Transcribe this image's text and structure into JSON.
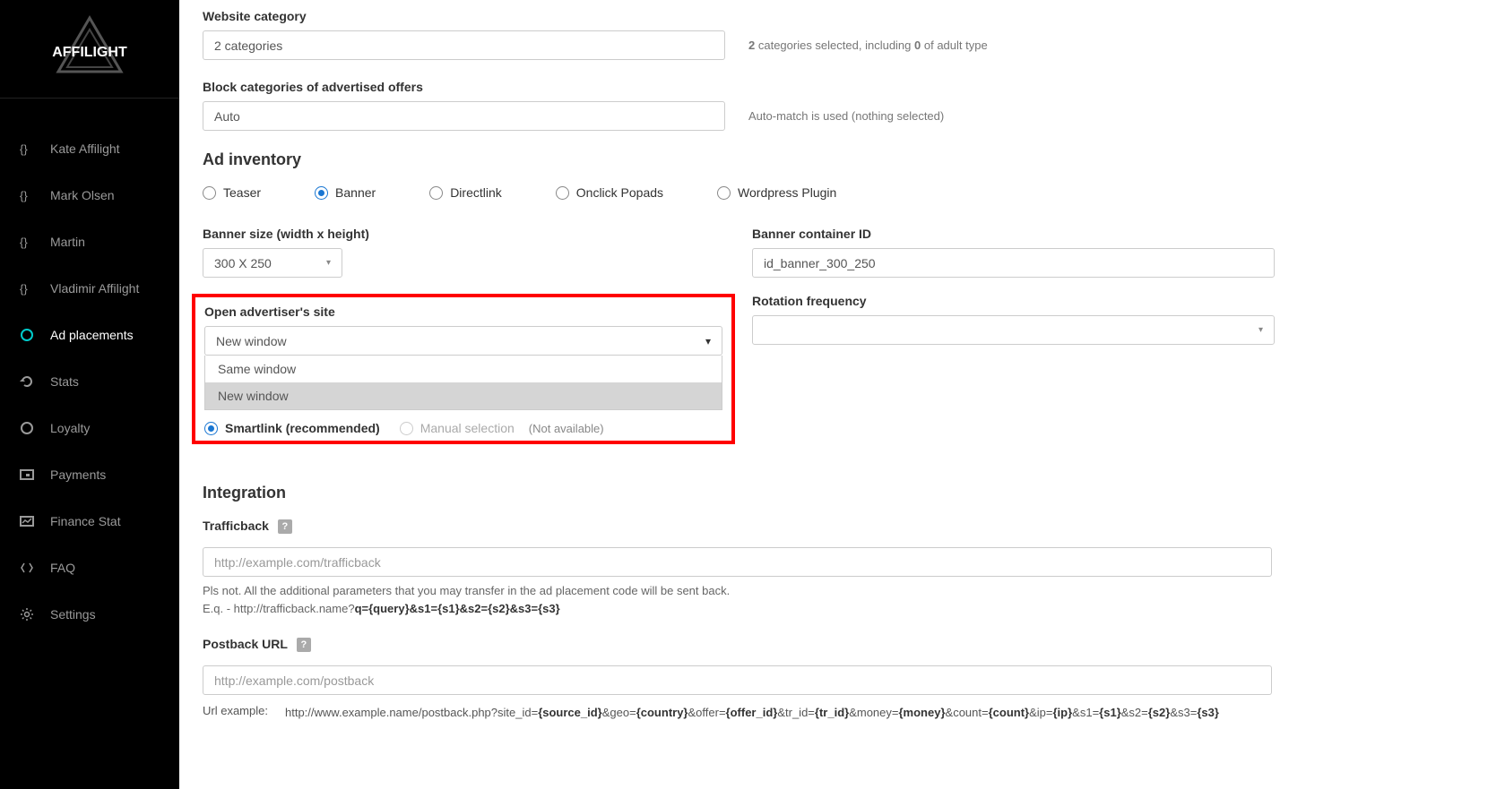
{
  "brand": "AFFILIGHT",
  "sidebar": {
    "users": [
      {
        "label": "Kate Affilight"
      },
      {
        "label": "Mark Olsen"
      },
      {
        "label": "Martin"
      },
      {
        "label": "Vladimir Affilight"
      }
    ],
    "nav": [
      {
        "label": "Ad placements",
        "active": true,
        "icon": "placements"
      },
      {
        "label": "Stats",
        "icon": "stats"
      },
      {
        "label": "Loyalty",
        "icon": "loyalty"
      },
      {
        "label": "Payments",
        "icon": "payments"
      },
      {
        "label": "Finance Stat",
        "icon": "finance"
      },
      {
        "label": "FAQ",
        "icon": "faq"
      },
      {
        "label": "Settings",
        "icon": "settings"
      }
    ]
  },
  "form": {
    "website_category": {
      "label": "Website category",
      "value": "2 categories",
      "helper_pre": "2",
      "helper_mid": " categories selected, including ",
      "helper_bold2": "0",
      "helper_post": " of adult type"
    },
    "block_categories": {
      "label": "Block categories of advertised offers",
      "value": "Auto",
      "helper": "Auto-match is used (nothing selected)"
    },
    "ad_inventory": {
      "title": "Ad inventory",
      "options": [
        "Teaser",
        "Banner",
        "Directlink",
        "Onclick Popads",
        "Wordpress Plugin"
      ],
      "selected": "Banner"
    },
    "banner_size": {
      "label": "Banner size (width x height)",
      "value": "300 X 250"
    },
    "banner_container": {
      "label": "Banner container ID",
      "value": "id_banner_300_250"
    },
    "open_site": {
      "label": "Open advertiser's site",
      "selected": "New window",
      "options": [
        "Same window",
        "New window"
      ]
    },
    "rotation": {
      "label": "Rotation frequency",
      "value": ""
    },
    "link_mode": {
      "smartlink": "Smartlink (recommended)",
      "manual": "Manual selection",
      "not_available": "(Not available)"
    },
    "integration": {
      "title": "Integration",
      "trafficback": {
        "label": "Trafficback",
        "placeholder": "http://example.com/trafficback",
        "note1": "Pls not. All the additional parameters that you may transfer in the ad placement code will be sent back.",
        "note2_pre": "E.q. - http://trafficback.name?",
        "note2_bold": "q={query}&s1={s1}&s2={s2}&s3={s3}"
      },
      "postback": {
        "label": "Postback URL",
        "placeholder": "http://example.com/postback",
        "url_example_label": "Url example:",
        "url_pre": "http://www.example.name/postback.php?site_id=",
        "parts": [
          {
            "b": "{source_id}"
          },
          {
            "t": "&geo="
          },
          {
            "b": "{country}"
          },
          {
            "t": "&offer="
          },
          {
            "b": "{offer_id}"
          },
          {
            "t": "&tr_id="
          },
          {
            "b": "{tr_id}"
          },
          {
            "t": "&money="
          },
          {
            "b": "{money}"
          },
          {
            "t": "&count="
          },
          {
            "b": "{count}"
          },
          {
            "t": "&ip="
          },
          {
            "b": "{ip}"
          },
          {
            "t": "&s1="
          },
          {
            "b": "{s1}"
          },
          {
            "t": "&s2="
          },
          {
            "b": "{s2}"
          },
          {
            "t": "&s3="
          },
          {
            "b": "{s3}"
          }
        ]
      }
    }
  }
}
